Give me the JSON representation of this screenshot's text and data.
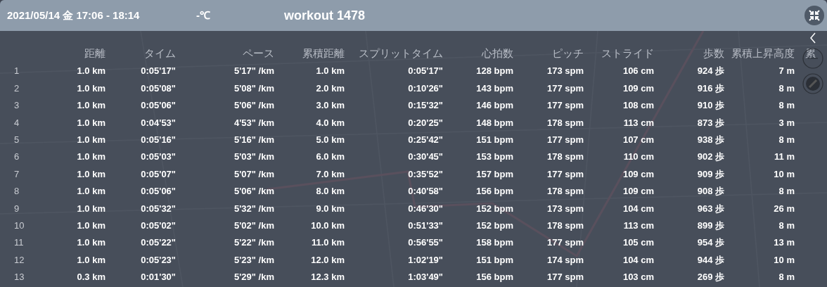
{
  "header": {
    "date_range": "2021/05/14 金 17:06 - 18:14",
    "temperature": "-℃",
    "title": "workout 1478"
  },
  "table": {
    "columns": [
      "距離",
      "タイム",
      "ペース",
      "累積距離",
      "スプリットタイム",
      "心拍数",
      "ピッチ",
      "ストライド",
      "歩数",
      "累積上昇高度",
      "累"
    ],
    "rows": [
      {
        "index": "1",
        "cells": [
          "1.0 km",
          "0:05'17\"",
          "5'17\" /km",
          "1.0 km",
          "0:05'17\"",
          "128 bpm",
          "173 spm",
          "106 cm",
          "924 歩",
          "7 m"
        ]
      },
      {
        "index": "2",
        "cells": [
          "1.0 km",
          "0:05'08\"",
          "5'08\" /km",
          "2.0 km",
          "0:10'26\"",
          "143 bpm",
          "177 spm",
          "109 cm",
          "916 歩",
          "8 m"
        ]
      },
      {
        "index": "3",
        "cells": [
          "1.0 km",
          "0:05'06\"",
          "5'06\" /km",
          "3.0 km",
          "0:15'32\"",
          "146 bpm",
          "177 spm",
          "108 cm",
          "910 歩",
          "8 m"
        ]
      },
      {
        "index": "4",
        "cells": [
          "1.0 km",
          "0:04'53\"",
          "4'53\" /km",
          "4.0 km",
          "0:20'25\"",
          "148 bpm",
          "178 spm",
          "113 cm",
          "873 歩",
          "3 m"
        ]
      },
      {
        "index": "5",
        "cells": [
          "1.0 km",
          "0:05'16\"",
          "5'16\" /km",
          "5.0 km",
          "0:25'42\"",
          "151 bpm",
          "177 spm",
          "107 cm",
          "938 歩",
          "8 m"
        ]
      },
      {
        "index": "6",
        "cells": [
          "1.0 km",
          "0:05'03\"",
          "5'03\" /km",
          "6.0 km",
          "0:30'45\"",
          "153 bpm",
          "178 spm",
          "110 cm",
          "902 歩",
          "11 m"
        ]
      },
      {
        "index": "7",
        "cells": [
          "1.0 km",
          "0:05'07\"",
          "5'07\" /km",
          "7.0 km",
          "0:35'52\"",
          "157 bpm",
          "177 spm",
          "109 cm",
          "909 歩",
          "10 m"
        ]
      },
      {
        "index": "8",
        "cells": [
          "1.0 km",
          "0:05'06\"",
          "5'06\" /km",
          "8.0 km",
          "0:40'58\"",
          "156 bpm",
          "178 spm",
          "109 cm",
          "908 歩",
          "8 m"
        ]
      },
      {
        "index": "9",
        "cells": [
          "1.0 km",
          "0:05'32\"",
          "5'32\" /km",
          "9.0 km",
          "0:46'30\"",
          "152 bpm",
          "173 spm",
          "104 cm",
          "963 歩",
          "26 m"
        ]
      },
      {
        "index": "10",
        "cells": [
          "1.0 km",
          "0:05'02\"",
          "5'02\" /km",
          "10.0 km",
          "0:51'33\"",
          "152 bpm",
          "178 spm",
          "113 cm",
          "899 歩",
          "8 m"
        ]
      },
      {
        "index": "11",
        "cells": [
          "1.0 km",
          "0:05'22\"",
          "5'22\" /km",
          "11.0 km",
          "0:56'55\"",
          "158 bpm",
          "177 spm",
          "105 cm",
          "954 歩",
          "13 m"
        ]
      },
      {
        "index": "12",
        "cells": [
          "1.0 km",
          "0:05'23\"",
          "5'23\" /km",
          "12.0 km",
          "1:02'19\"",
          "151 bpm",
          "174 spm",
          "104 cm",
          "944 歩",
          "10 m"
        ]
      },
      {
        "index": "13",
        "cells": [
          "0.3 km",
          "0:01'30\"",
          "5'29\" /km",
          "12.3 km",
          "1:03'49\"",
          "156 bpm",
          "177 spm",
          "103 cm",
          "269 歩",
          "8 m"
        ]
      }
    ]
  }
}
